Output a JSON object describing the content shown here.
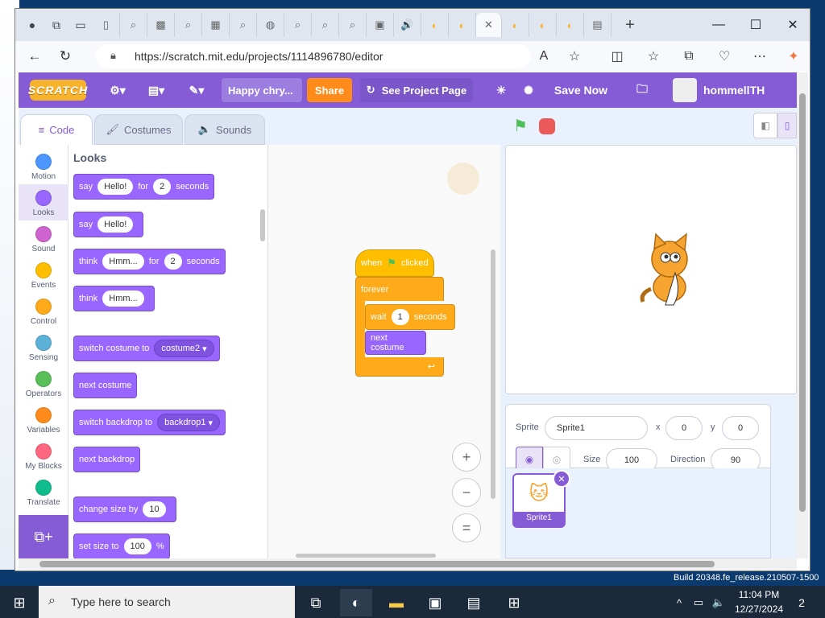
{
  "browser": {
    "url": "https://scratch.mit.edu/projects/1114896780/editor",
    "new_tab_label": "+",
    "window_controls": {
      "minimize": "—",
      "maximize": "☐",
      "close": "✕"
    }
  },
  "scratch_menu": {
    "logo": "SCRATCH",
    "project_title": "Happy chry...",
    "share": "Share",
    "see_project_page": "See Project Page",
    "save_now": "Save Now",
    "username": "hommellTHIS"
  },
  "editor_tabs": {
    "code": "Code",
    "costumes": "Costumes",
    "sounds": "Sounds"
  },
  "categories": [
    {
      "label": "Motion",
      "color": "#4c97ff"
    },
    {
      "label": "Looks",
      "color": "#9966ff"
    },
    {
      "label": "Sound",
      "color": "#cf63cf"
    },
    {
      "label": "Events",
      "color": "#ffbf00"
    },
    {
      "label": "Control",
      "color": "#ffab19"
    },
    {
      "label": "Sensing",
      "color": "#5cb1d6"
    },
    {
      "label": "Operators",
      "color": "#59c059"
    },
    {
      "label": "Variables",
      "color": "#ff8c1a"
    },
    {
      "label": "My Blocks",
      "color": "#ff6680"
    },
    {
      "label": "Translate",
      "color": "#0fbd8c"
    }
  ],
  "palette": {
    "section": "Looks",
    "blocks": {
      "say_for": {
        "a": "say",
        "val": "Hello!",
        "b": "for",
        "num": "2",
        "c": "seconds"
      },
      "say": {
        "a": "say",
        "val": "Hello!"
      },
      "think_for": {
        "a": "think",
        "val": "Hmm...",
        "b": "for",
        "num": "2",
        "c": "seconds"
      },
      "think": {
        "a": "think",
        "val": "Hmm..."
      },
      "switch_costume": {
        "a": "switch costume to",
        "val": "costume2"
      },
      "next_costume": "next costume",
      "switch_backdrop": {
        "a": "switch backdrop to",
        "val": "backdrop1"
      },
      "next_backdrop": "next backdrop",
      "change_size": {
        "a": "change size by",
        "val": "10"
      },
      "set_size": {
        "a": "set size to",
        "val": "100",
        "b": "%"
      }
    }
  },
  "script": {
    "hat_a": "when",
    "hat_b": "clicked",
    "forever": "forever",
    "wait_a": "wait",
    "wait_val": "1",
    "wait_b": "seconds",
    "next_costume": "next costume"
  },
  "sprite_info": {
    "sprite_label": "Sprite",
    "sprite_name": "Sprite1",
    "x_label": "x",
    "x": "0",
    "y_label": "y",
    "y": "0",
    "size_label": "Size",
    "size": "100",
    "direction_label": "Direction",
    "direction": "90",
    "thumb_name": "Sprite1"
  },
  "system": {
    "build": "Build 20348.fe_release.210507-1500",
    "search_placeholder": "Type here to search",
    "time": "11:04 PM",
    "date": "12/27/2024",
    "notifications": "2"
  }
}
